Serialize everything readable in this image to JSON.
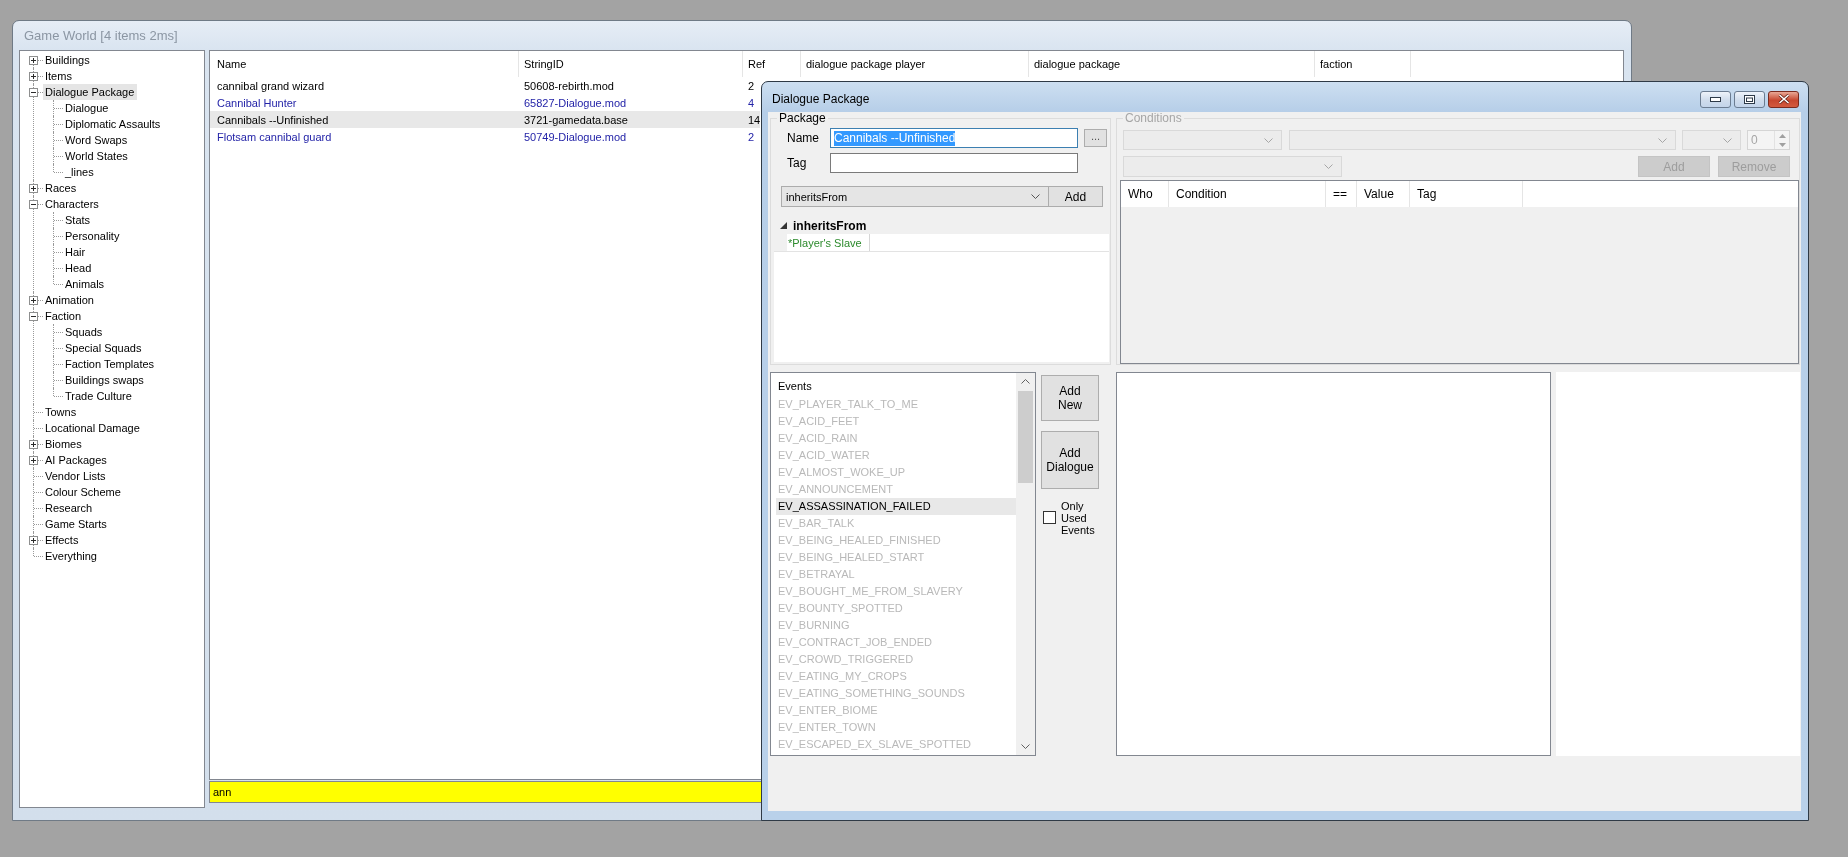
{
  "game_world": {
    "title": "Game World [4 items 2ms]",
    "tree": [
      {
        "label": "Buildings",
        "expanded": false,
        "selected": false
      },
      {
        "label": "Items",
        "expanded": false,
        "selected": false
      },
      {
        "label": "Dialogue Package",
        "expanded": true,
        "selected": true,
        "children": [
          {
            "label": "Dialogue",
            "selected": false
          },
          {
            "label": "Diplomatic Assaults",
            "selected": false
          },
          {
            "label": "Word Swaps",
            "selected": false
          },
          {
            "label": "World States",
            "selected": false
          },
          {
            "label": "_lines",
            "selected": false
          }
        ]
      },
      {
        "label": "Races",
        "expanded": false,
        "selected": false
      },
      {
        "label": "Characters",
        "expanded": true,
        "selected": false,
        "children": [
          {
            "label": "Stats",
            "selected": false
          },
          {
            "label": "Personality",
            "selected": false
          },
          {
            "label": "Hair",
            "selected": false
          },
          {
            "label": "Head",
            "selected": false
          },
          {
            "label": "Animals",
            "selected": false
          }
        ]
      },
      {
        "label": "Animation",
        "expanded": false,
        "selected": false
      },
      {
        "label": "Faction",
        "expanded": true,
        "selected": false,
        "children": [
          {
            "label": "Squads",
            "selected": false
          },
          {
            "label": "Special Squads",
            "selected": false
          },
          {
            "label": "Faction Templates",
            "selected": false
          },
          {
            "label": "Buildings swaps",
            "selected": false
          },
          {
            "label": "Trade Culture",
            "selected": false
          }
        ]
      },
      {
        "label": "Towns",
        "selected": false
      },
      {
        "label": "Locational Damage",
        "selected": false
      },
      {
        "label": "Biomes",
        "expanded": false,
        "selected": false
      },
      {
        "label": "AI Packages",
        "expanded": false,
        "selected": false
      },
      {
        "label": "Vendor Lists",
        "selected": false
      },
      {
        "label": "Colour Scheme",
        "selected": false
      },
      {
        "label": "Research",
        "selected": false
      },
      {
        "label": "Game Starts",
        "selected": false
      },
      {
        "label": "Effects",
        "expanded": false,
        "selected": false
      },
      {
        "label": "Everything",
        "selected": false
      }
    ],
    "table": {
      "columns": [
        "Name",
        "StringID",
        "Ref",
        "dialogue package player",
        "dialogue package",
        "faction"
      ],
      "rows": [
        {
          "cells": [
            "cannibal grand wizard",
            "50608-rebirth.mod",
            "2"
          ],
          "color": "#000000",
          "selected": false
        },
        {
          "cells": [
            "Cannibal Hunter",
            "65827-Dialogue.mod",
            "4"
          ],
          "color": "#2424a8",
          "selected": false
        },
        {
          "cells": [
            "Cannibals --Unfinished",
            "3721-gamedata.base",
            "14"
          ],
          "color": "#000000",
          "selected": true
        },
        {
          "cells": [
            "Flotsam cannibal guard",
            "50749-Dialogue.mod",
            "2"
          ],
          "color": "#2424a8",
          "selected": false
        }
      ]
    },
    "filter": {
      "value": "ann"
    }
  },
  "dialog": {
    "title": "Dialogue Package",
    "package": {
      "title": "Package",
      "name_label": "Name",
      "name_value": "Cannibals --Unfinished",
      "name_value_selected": true,
      "browse_button": "...",
      "tag_label": "Tag",
      "type_combo": "inheritsFrom",
      "add_button": "Add",
      "grid": [
        {
          "category": "inheritsFrom",
          "expanded": true,
          "properties": [
            {
              "name": "*Player's Slave"
            }
          ]
        }
      ]
    },
    "conditions": {
      "title": "Conditions",
      "disabled": true,
      "spin_value": "0",
      "buttons": [
        {
          "label": "Add",
          "disabled": true
        },
        {
          "label": "Remove",
          "disabled": true
        }
      ],
      "columns": [
        "Who",
        "Condition",
        "==",
        "Value",
        "Tag"
      ]
    },
    "events": {
      "header": "Events",
      "items": [
        {
          "label": "EV_PLAYER_TALK_TO_ME",
          "greyed": true,
          "selected": false
        },
        {
          "label": "EV_ACID_FEET",
          "greyed": true,
          "selected": false
        },
        {
          "label": "EV_ACID_RAIN",
          "greyed": true,
          "selected": false
        },
        {
          "label": "EV_ACID_WATER",
          "greyed": true,
          "selected": false
        },
        {
          "label": "EV_ALMOST_WOKE_UP",
          "greyed": true,
          "selected": false
        },
        {
          "label": "EV_ANNOUNCEMENT",
          "greyed": true,
          "selected": false
        },
        {
          "label": "EV_ASSASSINATION_FAILED",
          "greyed": false,
          "selected": true
        },
        {
          "label": "EV_BAR_TALK",
          "greyed": true,
          "selected": false
        },
        {
          "label": "EV_BEING_HEALED_FINISHED",
          "greyed": true,
          "selected": false
        },
        {
          "label": "EV_BEING_HEALED_START",
          "greyed": true,
          "selected": false
        },
        {
          "label": "EV_BETRAYAL",
          "greyed": true,
          "selected": false
        },
        {
          "label": "EV_BOUGHT_ME_FROM_SLAVERY",
          "greyed": true,
          "selected": false
        },
        {
          "label": "EV_BOUNTY_SPOTTED",
          "greyed": true,
          "selected": false
        },
        {
          "label": "EV_BURNING",
          "greyed": true,
          "selected": false
        },
        {
          "label": "EV_CONTRACT_JOB_ENDED",
          "greyed": true,
          "selected": false
        },
        {
          "label": "EV_CROWD_TRIGGERED",
          "greyed": true,
          "selected": false
        },
        {
          "label": "EV_EATING_MY_CROPS",
          "greyed": true,
          "selected": false
        },
        {
          "label": "EV_EATING_SOMETHING_SOUNDS",
          "greyed": true,
          "selected": false
        },
        {
          "label": "EV_ENTER_BIOME",
          "greyed": true,
          "selected": false
        },
        {
          "label": "EV_ENTER_TOWN",
          "greyed": true,
          "selected": false
        },
        {
          "label": "EV_ESCAPED_EX_SLAVE_SPOTTED",
          "greyed": true,
          "selected": false
        }
      ]
    },
    "buttons": [
      "Add New",
      "Add Dialogue"
    ],
    "only_used_events": {
      "label": "Only Used Events",
      "checked": false
    }
  }
}
